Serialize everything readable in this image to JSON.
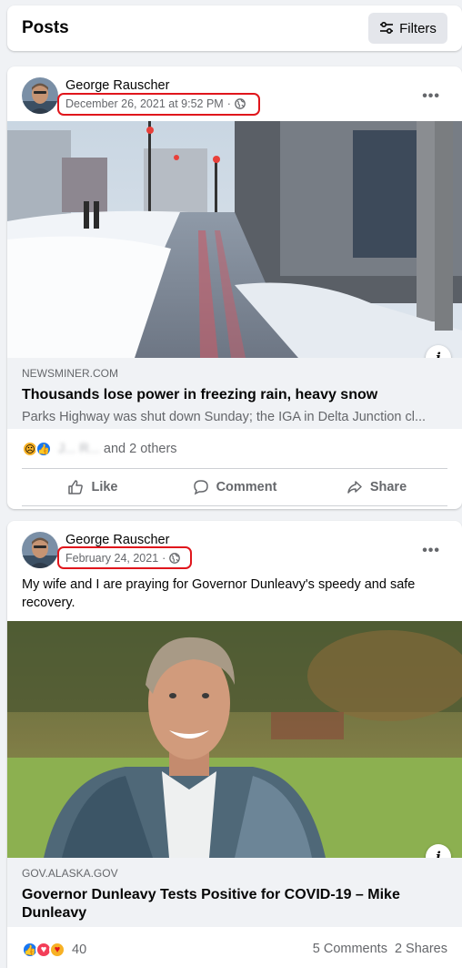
{
  "header": {
    "title": "Posts",
    "filters_label": "Filters"
  },
  "posts": [
    {
      "author": "George Rauscher",
      "timestamp": "December 26, 2021 at 9:52 PM",
      "privacy_icon": "globe-icon",
      "text": "",
      "link": {
        "domain": "NEWSMINER.COM",
        "title": "Thousands lose power in freezing rain, heavy snow",
        "description": "Parks Highway was shut down Sunday; the IGA in Delta Junction cl..."
      },
      "reactions": {
        "icons": [
          "sad",
          "like"
        ],
        "names_blurred": "J... R...",
        "others": "and 2 others"
      },
      "actions": {
        "like": "Like",
        "comment": "Comment",
        "share": "Share"
      }
    },
    {
      "author": "George Rauscher",
      "timestamp": "February 24, 2021",
      "privacy_icon": "globe-icon",
      "text": "My wife and I are praying for Governor Dunleavy's speedy and safe recovery.",
      "link": {
        "domain": "GOV.ALASKA.GOV",
        "title": "Governor Dunleavy Tests Positive for COVID-19 – Mike Dunleavy",
        "description": ""
      },
      "reactions": {
        "icons": [
          "like",
          "love",
          "care"
        ],
        "count": "40",
        "comments": "5 Comments",
        "shares": "2 Shares"
      }
    }
  ],
  "colors": {
    "highlight": "#e0161c",
    "like_blue": "#1877f2",
    "secondary_text": "#65676b"
  }
}
